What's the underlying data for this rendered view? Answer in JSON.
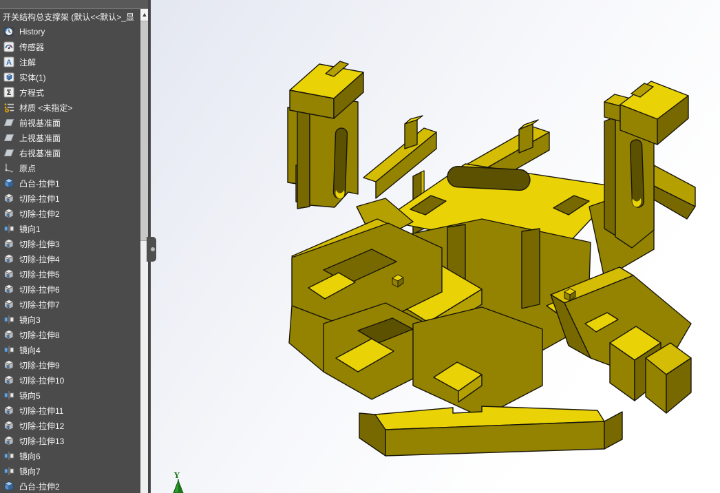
{
  "feature_tree": {
    "title": "开关结构总支撑架 (默认<<默认>_显",
    "items": [
      {
        "label": "History",
        "icon": "history-icon"
      },
      {
        "label": "传感器",
        "icon": "sensor-icon"
      },
      {
        "label": "注解",
        "icon": "annotations-icon"
      },
      {
        "label": "实体(1)",
        "icon": "solid-bodies-icon"
      },
      {
        "label": "方程式",
        "icon": "equations-icon"
      },
      {
        "label": "材质 <未指定>",
        "icon": "material-icon"
      },
      {
        "label": "前视基准面",
        "icon": "plane-icon"
      },
      {
        "label": "上视基准面",
        "icon": "plane-icon"
      },
      {
        "label": "右视基准面",
        "icon": "plane-icon"
      },
      {
        "label": "原点",
        "icon": "origin-icon"
      },
      {
        "label": "凸台-拉伸1",
        "icon": "boss-extrude-icon"
      },
      {
        "label": "切除-拉伸1",
        "icon": "cut-extrude-icon"
      },
      {
        "label": "切除-拉伸2",
        "icon": "cut-extrude-icon"
      },
      {
        "label": "镜向1",
        "icon": "mirror-icon"
      },
      {
        "label": "切除-拉伸3",
        "icon": "cut-extrude-icon"
      },
      {
        "label": "切除-拉伸4",
        "icon": "cut-extrude-icon"
      },
      {
        "label": "切除-拉伸5",
        "icon": "cut-extrude-icon"
      },
      {
        "label": "切除-拉伸6",
        "icon": "cut-extrude-icon"
      },
      {
        "label": "切除-拉伸7",
        "icon": "cut-extrude-icon"
      },
      {
        "label": "镜向3",
        "icon": "mirror-icon"
      },
      {
        "label": "切除-拉伸8",
        "icon": "cut-extrude-icon"
      },
      {
        "label": "镜向4",
        "icon": "mirror-icon"
      },
      {
        "label": "切除-拉伸9",
        "icon": "cut-extrude-icon"
      },
      {
        "label": "切除-拉伸10",
        "icon": "cut-extrude-icon"
      },
      {
        "label": "镜向5",
        "icon": "mirror-icon"
      },
      {
        "label": "切除-拉伸11",
        "icon": "cut-extrude-icon"
      },
      {
        "label": "切除-拉伸12",
        "icon": "cut-extrude-icon"
      },
      {
        "label": "切除-拉伸13",
        "icon": "cut-extrude-icon"
      },
      {
        "label": "镜向6",
        "icon": "mirror-icon"
      },
      {
        "label": "镜向7",
        "icon": "mirror-icon"
      },
      {
        "label": "凸台-拉伸2",
        "icon": "boss-extrude-icon"
      }
    ]
  },
  "scrollbar": {
    "up_arrow": "▲"
  },
  "viewport": {
    "triad_y_label": "Y",
    "part_bright_color": "#e9d206",
    "part_olive_color": "#948300",
    "edge_color": "#17150a",
    "background_top": "#dce1ec",
    "background_bottom": "#ffffff"
  }
}
